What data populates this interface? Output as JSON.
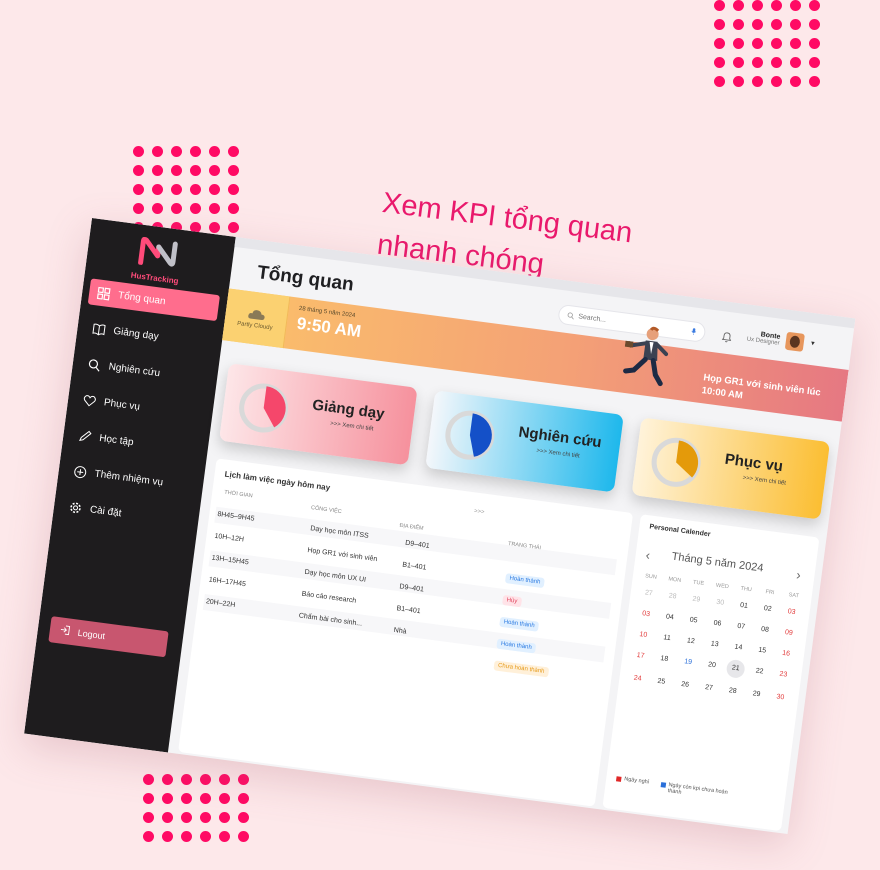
{
  "headline": {
    "line1": "Xem KPI tổng quan",
    "line2": "nhanh chóng"
  },
  "colors": {
    "brand": "#ff0a64",
    "nav_active": "#ff6d8d",
    "logout": "#c8566f",
    "sidebar": "#1e1c1e"
  },
  "logo": {
    "text": "HusTracking"
  },
  "sidebar": {
    "items": [
      {
        "label": "Tổng quan",
        "icon": "grid-icon",
        "active": true
      },
      {
        "label": "Giảng dạy",
        "icon": "book-icon"
      },
      {
        "label": "Nghiên cứu",
        "icon": "search-icon"
      },
      {
        "label": "Phục vụ",
        "icon": "heart-icon"
      },
      {
        "label": "Học tập",
        "icon": "pencil-icon"
      },
      {
        "label": "Thêm nhiệm vụ",
        "icon": "plus-circle-icon"
      },
      {
        "label": "Cài đặt",
        "icon": "gear-icon"
      }
    ],
    "logout": "Logout"
  },
  "header": {
    "title": "Tổng quan",
    "search_placeholder": "Search...",
    "user_name": "Bonte",
    "user_role": "Ux Designer"
  },
  "banner": {
    "weather": "Partly Cloudy",
    "date": "28 tháng 5 năm 2024",
    "time": "9:50 AM",
    "meeting_line1": "Họp GR1 với sinh viên lúc",
    "meeting_line2": "10:00 AM"
  },
  "cards": [
    {
      "title": "Giảng dạy",
      "link": ">>> Xem chi tiết",
      "progress": 0.4,
      "color": "#f5476b"
    },
    {
      "title": "Nghiên cứu",
      "link": ">>> Xem chi tiết",
      "progress": 0.45,
      "color": "#1450c8"
    },
    {
      "title": "Phục vụ",
      "link": ">>> Xem chi tiết",
      "progress": 0.35,
      "color": "#e49a0a"
    }
  ],
  "schedule": {
    "title": "Lịch làm việc ngày hôm nay",
    "more": ">>>",
    "columns": [
      "THỜI GIAN",
      "CÔNG VIỆC",
      "ĐỊA ĐIỂM",
      "TRẠNG THÁI"
    ],
    "rows": [
      {
        "time": "8H45–9H45",
        "task": "Dạy học môn ITSS",
        "place": "D9–401",
        "status": ""
      },
      {
        "time": "10H–12H",
        "task": "Họp GR1 với sinh viên",
        "place": "B1–401",
        "status": "Hoàn thành"
      },
      {
        "time": "13H–15H45",
        "task": "Dạy học môn UX UI",
        "place": "D9–401",
        "status": "Hủy"
      },
      {
        "time": "16H–17H45",
        "task": "Báo cáo research",
        "place": "B1–401",
        "status": "Hoàn thành"
      },
      {
        "time": "20H–22H",
        "task": "Chấm bài cho sinh...",
        "place": "Nhà",
        "status": "Hoàn thành"
      },
      {
        "time": "",
        "task": "",
        "place": "",
        "status": "Chưa hoàn thành"
      }
    ]
  },
  "calendar": {
    "title": "Personal Calender",
    "month": "Tháng 5 năm 2024",
    "weekdays": [
      "SUN",
      "MON",
      "TUE",
      "WED",
      "THU",
      "FRI",
      "SAT"
    ],
    "weeks": [
      [
        "27",
        "28",
        "29",
        "30",
        "01",
        "02",
        "03"
      ],
      [
        "03",
        "04",
        "05",
        "06",
        "07",
        "08",
        "09"
      ],
      [
        "10",
        "11",
        "12",
        "13",
        "14",
        "15",
        "16"
      ],
      [
        "17",
        "18",
        "19",
        "20",
        "21",
        "22",
        "23"
      ],
      [
        "24",
        "25",
        "26",
        "27",
        "28",
        "29",
        "30"
      ]
    ],
    "today": "21",
    "legend_holiday": "Ngày nghỉ",
    "legend_kpi": "Ngày còn kpi chưa hoàn thành"
  }
}
